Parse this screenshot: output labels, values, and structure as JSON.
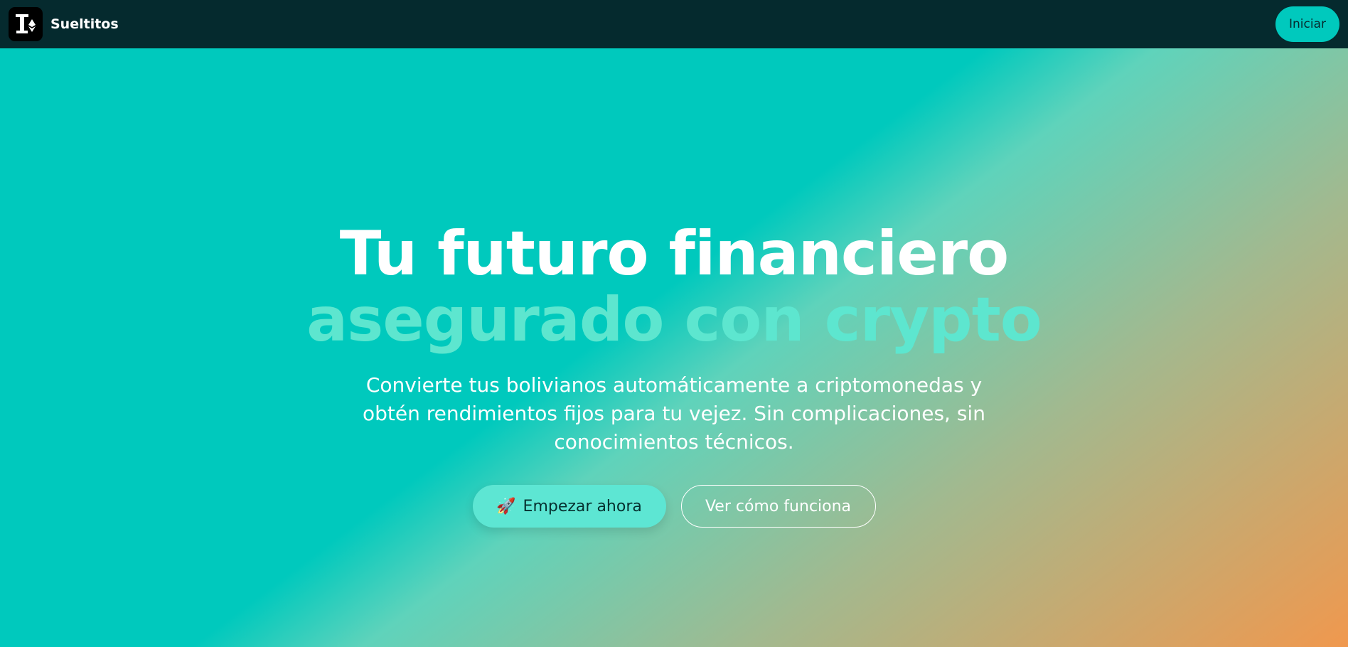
{
  "brand": {
    "name": "Sueltitos",
    "logo_icon": "piggy-tool-logo-icon"
  },
  "nav": {
    "login_label": "Iniciar"
  },
  "hero": {
    "title_line1": "Tu futuro financiero",
    "title_line2": "asegurado con crypto",
    "subtitle": "Convierte tus bolivianos automáticamente a criptomonedas y obtén rendimientos fijos para tu vejez. Sin complicaciones, sin conocimientos técnicos.",
    "primary_cta": {
      "icon": "rocket-icon",
      "emoji": "🚀",
      "label": "Empezar ahora"
    },
    "secondary_cta": {
      "label": "Ver cómo funciona"
    }
  },
  "colors": {
    "navbar": "#052a2e",
    "accent": "#00c9bd",
    "highlight": "#5de6cf",
    "gradient_end": "#f0984e"
  }
}
